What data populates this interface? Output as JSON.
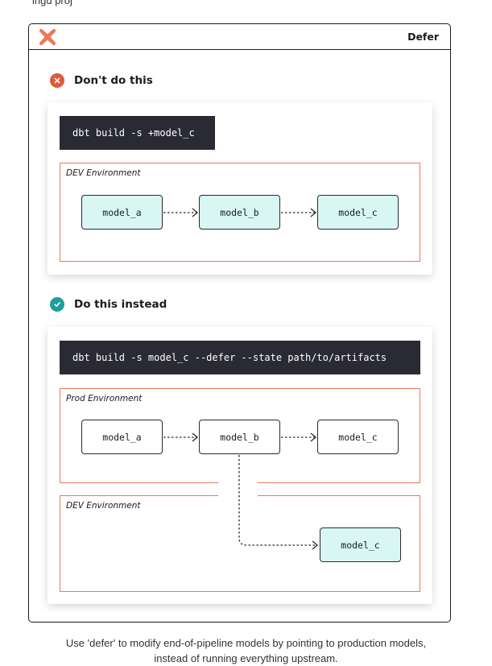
{
  "top_text": "ingu proj",
  "card": {
    "title": "Defer",
    "logo_icon": "dbt-logo-icon"
  },
  "colors": {
    "accent": "#ec7a54",
    "dont": "#e05a3a",
    "do": "#1f9e9a",
    "dev_node": "#d8f6f2",
    "cmd_bg": "#2a2a35"
  },
  "dont_section": {
    "title": "Don't do this",
    "icon": "x-circle-icon",
    "command": "dbt build -s +model_c",
    "env_label": "DEV Environment",
    "nodes": [
      "model_a",
      "model_b",
      "model_c"
    ]
  },
  "do_section": {
    "title": "Do this instead",
    "icon": "check-circle-icon",
    "command": "dbt build -s model_c --defer --state path/to/artifacts",
    "prod_env_label": "Prod Environment",
    "prod_nodes": [
      "model_a",
      "model_b",
      "model_c"
    ],
    "dev_env_label": "DEV Environment",
    "dev_node": "model_c"
  },
  "caption": {
    "line1": "Use 'defer' to modify end-of-pipeline models by pointing to production models,",
    "line2": "instead of running everything upstream."
  }
}
